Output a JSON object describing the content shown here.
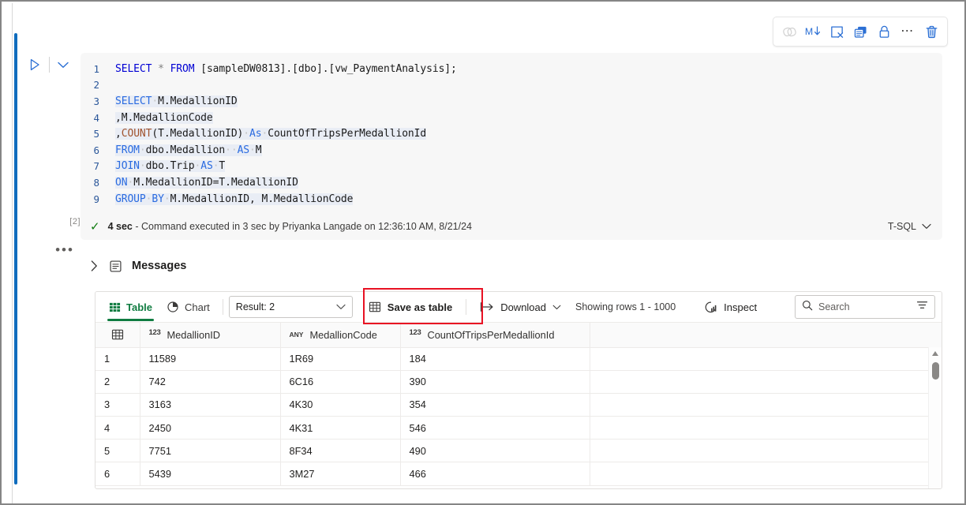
{
  "cell": {
    "run_label": "Run cell",
    "collapse_label": "Collapse",
    "execution_count": "[2]",
    "more_label": "•••"
  },
  "cell_toolbar": {
    "buttons": [
      {
        "name": "toggle-parameter-cell-icon",
        "label": "Toggle parameter cell",
        "glyph": "parameter"
      },
      {
        "name": "convert-to-markdown-icon",
        "label": "M↓",
        "glyph": "markdown"
      },
      {
        "name": "clear-output-icon",
        "label": "Clear output",
        "glyph": "clear-output"
      },
      {
        "name": "duplicate-cell-icon",
        "label": "Duplicate cell",
        "glyph": "duplicate"
      },
      {
        "name": "freeze-cell-icon",
        "label": "Freeze cell",
        "glyph": "lock"
      },
      {
        "name": "more-options-icon",
        "label": "…",
        "glyph": "ellipsis"
      },
      {
        "name": "delete-cell-icon",
        "label": "Delete cell",
        "glyph": "trash"
      }
    ]
  },
  "editor": {
    "lines": [
      {
        "n": "1",
        "tokens": [
          {
            "t": "SELECT",
            "c": "kw"
          },
          {
            "t": " ",
            "c": "pn"
          },
          {
            "t": "*",
            "c": "op"
          },
          {
            "t": " ",
            "c": "pn"
          },
          {
            "t": "FROM",
            "c": "kw"
          },
          {
            "t": " [sampleDW0813].[dbo].[vw_PaymentAnalysis];",
            "c": "pn"
          }
        ]
      },
      {
        "n": "2",
        "tokens": []
      },
      {
        "n": "3",
        "hl": true,
        "tokens": [
          {
            "t": "SELECT",
            "c": "kw2"
          },
          {
            "t": "·",
            "c": "dot"
          },
          {
            "t": "M.MedallionID",
            "c": "pn"
          }
        ]
      },
      {
        "n": "4",
        "hl": true,
        "tokens": [
          {
            "t": ",M.MedallionCode",
            "c": "pn"
          }
        ]
      },
      {
        "n": "5",
        "hl": true,
        "tokens": [
          {
            "t": ",",
            "c": "pn"
          },
          {
            "t": "COUNT",
            "c": "fn"
          },
          {
            "t": "(T.MedallionID)",
            "c": "pn"
          },
          {
            "t": "·",
            "c": "dot"
          },
          {
            "t": "As",
            "c": "kw2"
          },
          {
            "t": "·",
            "c": "dot"
          },
          {
            "t": "CountOfTripsPerMedallionId",
            "c": "pn"
          }
        ]
      },
      {
        "n": "6",
        "hl": true,
        "tokens": [
          {
            "t": "FROM",
            "c": "kw2"
          },
          {
            "t": "·",
            "c": "dot"
          },
          {
            "t": "dbo.Medallion",
            "c": "pn"
          },
          {
            "t": "··",
            "c": "dot"
          },
          {
            "t": "AS",
            "c": "kw2"
          },
          {
            "t": "·",
            "c": "dot"
          },
          {
            "t": "M",
            "c": "pn"
          }
        ]
      },
      {
        "n": "7",
        "hl": true,
        "tokens": [
          {
            "t": "JOIN",
            "c": "kw2"
          },
          {
            "t": "·",
            "c": "dot"
          },
          {
            "t": "dbo.Trip",
            "c": "pn"
          },
          {
            "t": "·",
            "c": "dot"
          },
          {
            "t": "AS",
            "c": "kw2"
          },
          {
            "t": "·",
            "c": "dot"
          },
          {
            "t": "T",
            "c": "pn"
          }
        ]
      },
      {
        "n": "8",
        "hl": true,
        "tokens": [
          {
            "t": "ON",
            "c": "kw2"
          },
          {
            "t": "·",
            "c": "dot"
          },
          {
            "t": "M.MedallionID=T.MedallionID",
            "c": "pn"
          }
        ]
      },
      {
        "n": "9",
        "hl": true,
        "tokens": [
          {
            "t": "GROUP",
            "c": "kw2"
          },
          {
            "t": "·",
            "c": "dot"
          },
          {
            "t": "BY",
            "c": "kw2"
          },
          {
            "t": "·",
            "c": "dot"
          },
          {
            "t": "M.MedallionID, M.MedallionCode",
            "c": "pn"
          }
        ]
      }
    ]
  },
  "status": {
    "check_icon": "✓",
    "duration": "4 sec",
    "message": " - Command executed in 3 sec by Priyanka Langade on 12:36:10 AM, 8/21/24",
    "language": "T-SQL"
  },
  "messages": {
    "label": "Messages",
    "expanded": false
  },
  "results_toolbar": {
    "table_tab": "Table",
    "chart_tab": "Chart",
    "result_select": "Result: 2",
    "save_as_table": "Save as table",
    "download": "Download",
    "showing_rows": "Showing rows 1 - 1000",
    "inspect": "Inspect",
    "search_placeholder": "Search",
    "search_value": ""
  },
  "annotation": {
    "color": "#e81123",
    "target": "save-as-table-button"
  },
  "grid": {
    "columns": [
      {
        "label": "",
        "type": ""
      },
      {
        "label": "MedallionID",
        "type": "123"
      },
      {
        "label": "MedallionCode",
        "type": "ANY"
      },
      {
        "label": "CountOfTripsPerMedallionId",
        "type": "123"
      },
      {
        "label": "",
        "type": ""
      }
    ],
    "rows": [
      {
        "idx": "1",
        "MedallionID": "11589",
        "MedallionCode": "1R69",
        "CountOfTripsPerMedallionId": "184"
      },
      {
        "idx": "2",
        "MedallionID": "742",
        "MedallionCode": "6C16",
        "CountOfTripsPerMedallionId": "390"
      },
      {
        "idx": "3",
        "MedallionID": "3163",
        "MedallionCode": "4K30",
        "CountOfTripsPerMedallionId": "354"
      },
      {
        "idx": "4",
        "MedallionID": "2450",
        "MedallionCode": "4K31",
        "CountOfTripsPerMedallionId": "546"
      },
      {
        "idx": "5",
        "MedallionID": "7751",
        "MedallionCode": "8F34",
        "CountOfTripsPerMedallionId": "490"
      },
      {
        "idx": "6",
        "MedallionID": "5439",
        "MedallionCode": "3M27",
        "CountOfTripsPerMedallionId": "466"
      }
    ]
  },
  "colors": {
    "accent_blue": "#0f6cbd",
    "tab_green": "#107c41",
    "success_green": "#107c10",
    "annotation_red": "#e81123"
  }
}
